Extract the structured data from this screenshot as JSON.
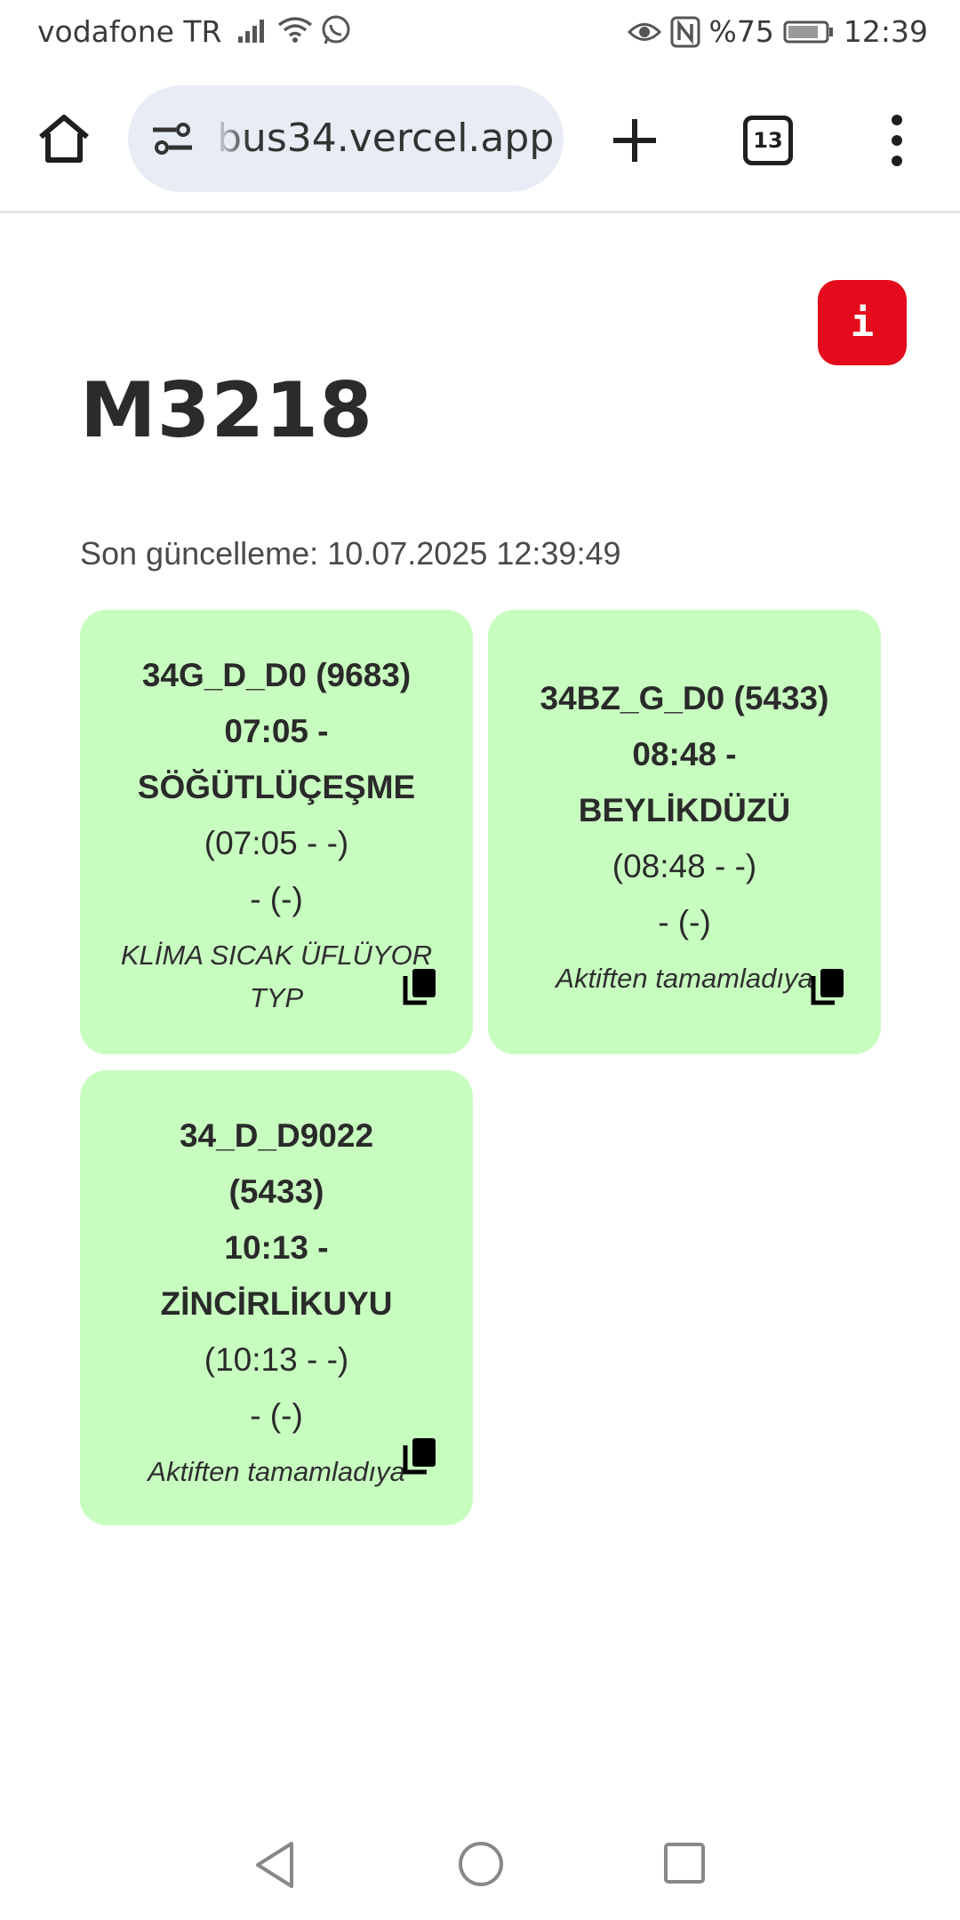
{
  "status_bar": {
    "carrier": "vodafone TR",
    "battery_text": "%75",
    "time": "12:39"
  },
  "browser": {
    "url": "bus34.vercel.app",
    "tab_count": "13"
  },
  "page": {
    "info_label": "i",
    "title": "M3218",
    "last_update": "Son güncelleme: 10.07.2025 12:39:49",
    "cards": [
      {
        "lines_bold": [
          "34G_D_D0 (9683)",
          "07:05 -",
          "SÖĞÜTLÜÇEŞME"
        ],
        "lines_regular": [
          "(07:05 - -)",
          "- (-)"
        ],
        "note": "KLİMA SICAK ÜFLÜYOR TYP"
      },
      {
        "lines_bold": [
          "34BZ_G_D0 (5433)",
          "08:48 -",
          "BEYLİKDÜZÜ"
        ],
        "lines_regular": [
          "(08:48 - -)",
          "- (-)"
        ],
        "note": "Aktiften tamamladıya"
      },
      {
        "lines_bold": [
          "34_D_D9022",
          "(5433)",
          "10:13 -",
          "ZİNCİRLİKUYU"
        ],
        "lines_regular": [
          "(10:13 - -)",
          "- (-)"
        ],
        "note": "Aktiften tamamladıya"
      }
    ]
  },
  "colors": {
    "card_bg": "#c8fdc0",
    "info_button": "#e40b1c",
    "urlbar_bg": "#e8ecf5"
  }
}
